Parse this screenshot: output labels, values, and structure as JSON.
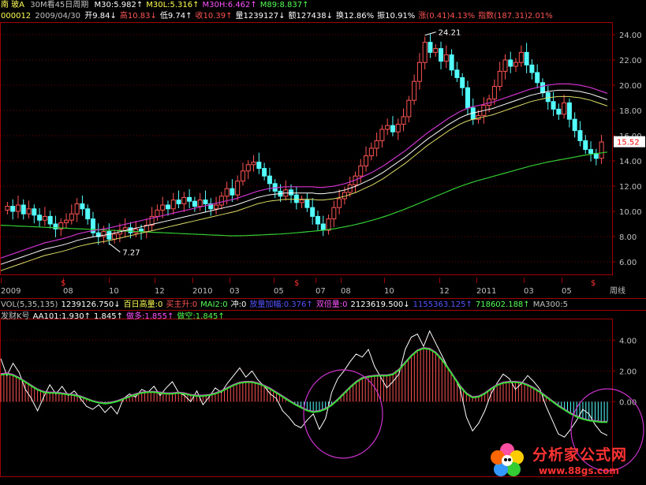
{
  "header": {
    "name": "南  玻A",
    "period": "30M看45日周期",
    "ma": [
      {
        "label": "M30:5.982↑",
        "color": "#ffffff"
      },
      {
        "label": "M30L:5.316↑",
        "color": "#ffff54"
      },
      {
        "label": "M30H:6.462↑",
        "color": "#ff54ff"
      },
      {
        "label": "M89:8.837↑",
        "color": "#54ff54"
      }
    ],
    "code": "000012",
    "date": "2009/04/30",
    "fields": [
      {
        "label": "开9.84↓",
        "color": "#ffffff"
      },
      {
        "label": "高10.83↓",
        "color": "#ff5454"
      },
      {
        "label": "低9.74↑",
        "color": "#ffffff"
      },
      {
        "label": "收10.39↑",
        "color": "#ff5454"
      },
      {
        "label": "量1239127↓",
        "color": "#ffffff"
      },
      {
        "label": "额127438↓",
        "color": "#ffffff"
      },
      {
        "label": "换12.86%",
        "color": "#ffffff"
      },
      {
        "label": "振10.91%",
        "color": "#ffffff"
      },
      {
        "label": "涨(0.41)4.13%",
        "color": "#ff5454"
      },
      {
        "label": "指数(187.31)2.01%",
        "color": "#ff5454"
      }
    ]
  },
  "vol_bar": {
    "items": [
      {
        "label": "VOL(5,35,135)",
        "color": "#c0c0c0"
      },
      {
        "label": "1239126.750↓",
        "color": "#ffffff"
      },
      {
        "label": "百日高量:0",
        "color": "#ffff54"
      },
      {
        "label": "买主升:0",
        "color": "#ff5454"
      },
      {
        "label": "MAI2:0",
        "color": "#54ff54"
      },
      {
        "label": "冲:0",
        "color": "#ffffff"
      },
      {
        "label": "放量加幅:0.376↑",
        "color": "#5454ff"
      },
      {
        "label": "双倍量:0",
        "color": "#ff54ff"
      },
      {
        "label": "2123619.500↓",
        "color": "#ffffff"
      },
      {
        "label": "1155363.125↑",
        "color": "#5454ff"
      },
      {
        "label": "718602.188↑",
        "color": "#54ff54"
      },
      {
        "label": "MA300:5",
        "color": "#c0c0c0"
      }
    ]
  },
  "ind_bar": {
    "items": [
      {
        "label": "发财K号",
        "color": "#c0c0c0"
      },
      {
        "label": "AA101:1.930↑",
        "color": "#ffffff"
      },
      {
        "label": "1.845↑",
        "color": "#ffffff"
      },
      {
        "label": "做多:1.855↑",
        "color": "#ff54ff"
      },
      {
        "label": "做空:1.845↑",
        "color": "#54ff54"
      }
    ]
  },
  "chart_data": [
    {
      "type": "line",
      "subtype": "candlestick",
      "y_ticks": [
        6.0,
        8.0,
        10.0,
        12.0,
        14.0,
        16.0,
        18.0,
        20.0,
        22.0,
        24.0
      ],
      "ylim": [
        5.0,
        25.0
      ],
      "x_ticks": [
        "2009",
        "08",
        "10",
        "12",
        "2010",
        "03",
        "05",
        "07",
        "08",
        "10",
        "12",
        "2011",
        "03",
        "05",
        "周线"
      ],
      "grid": true,
      "annotations": [
        {
          "label": "24.21",
          "value": 24.21
        },
        {
          "label": "7.27",
          "value": 7.27
        },
        {
          "label": "15.52",
          "value": 15.52
        }
      ],
      "dollar_marks": [
        "$",
        "$",
        "$"
      ],
      "closes": [
        10.4,
        10.0,
        10.5,
        9.8,
        10.2,
        9.7,
        9.3,
        9.6,
        9.0,
        8.6,
        9.1,
        9.3,
        9.8,
        10.6,
        10.2,
        9.4,
        8.3,
        8.0,
        8.4,
        7.8,
        8.2,
        8.5,
        8.7,
        8.3,
        8.6,
        8.4,
        8.9,
        9.6,
        10.1,
        10.5,
        10.2,
        10.9,
        10.6,
        11.1,
        10.8,
        10.4,
        10.9,
        10.6,
        10.2,
        10.5,
        11.2,
        11.8,
        11.3,
        12.4,
        13.2,
        13.7,
        13.9,
        13.4,
        12.8,
        12.2,
        11.6,
        11.2,
        11.7,
        11.3,
        10.7,
        10.9,
        10.3,
        9.6,
        9.0,
        8.5,
        9.4,
        10.3,
        11.0,
        11.5,
        12.1,
        12.8,
        13.6,
        14.4,
        15.0,
        15.6,
        16.5,
        16.8,
        16.3,
        16.9,
        17.5,
        18.8,
        20.3,
        21.8,
        23.4,
        22.6,
        22.9,
        21.9,
        22.4,
        21.2,
        20.6,
        19.8,
        18.2,
        17.3,
        17.6,
        18.4,
        18.9,
        19.9,
        21.1,
        22.0,
        21.5,
        21.8,
        22.6,
        21.6,
        21.0,
        20.2,
        19.4,
        18.7,
        18.1,
        17.7,
        18.6,
        17.3,
        16.4,
        15.6,
        14.9,
        14.6,
        14.2,
        15.5
      ],
      "ma_white": [
        5.8,
        5.95,
        6.1,
        6.25,
        6.4,
        6.55,
        6.7,
        6.85,
        7.0,
        7.1,
        7.2,
        7.3,
        7.42,
        7.55,
        7.7,
        7.8,
        7.9,
        7.98,
        8.05,
        8.12,
        8.2,
        8.3,
        8.4,
        8.5,
        8.6,
        8.7,
        8.8,
        8.9,
        9.0,
        9.1,
        9.2,
        9.3,
        9.4,
        9.5,
        9.6,
        9.7,
        9.8,
        9.9,
        10.0,
        10.1,
        10.2,
        10.3,
        10.4,
        10.5,
        10.65,
        10.8,
        10.95,
        11.1,
        11.2,
        11.3,
        11.35,
        11.4,
        11.45,
        11.45,
        11.45,
        11.45,
        11.45,
        11.45,
        11.4,
        11.4,
        11.45,
        11.5,
        11.6,
        11.7,
        11.85,
        12.0,
        12.2,
        12.4,
        12.6,
        12.85,
        13.1,
        13.4,
        13.7,
        14.0,
        14.3,
        14.65,
        15.0,
        15.35,
        15.7,
        16.0,
        16.3,
        16.6,
        16.9,
        17.15,
        17.4,
        17.6,
        17.75,
        17.85,
        17.95,
        18.05,
        18.15,
        18.3,
        18.45,
        18.6,
        18.75,
        18.9,
        19.05,
        19.2,
        19.3,
        19.4,
        19.5,
        19.55,
        19.6,
        19.6,
        19.6,
        19.55,
        19.5,
        19.4,
        19.3,
        19.15,
        19.0,
        18.85
      ],
      "ma_yellow": [
        5.3,
        5.45,
        5.6,
        5.75,
        5.9,
        6.05,
        6.2,
        6.35,
        6.5,
        6.6,
        6.7,
        6.8,
        6.92,
        7.05,
        7.2,
        7.3,
        7.4,
        7.48,
        7.55,
        7.62,
        7.7,
        7.8,
        7.9,
        8.0,
        8.1,
        8.2,
        8.3,
        8.4,
        8.5,
        8.6,
        8.7,
        8.8,
        8.9,
        9.0,
        9.1,
        9.2,
        9.3,
        9.4,
        9.5,
        9.6,
        9.7,
        9.8,
        9.9,
        10.0,
        10.15,
        10.3,
        10.45,
        10.6,
        10.7,
        10.8,
        10.85,
        10.9,
        10.95,
        10.95,
        10.95,
        10.95,
        10.95,
        10.95,
        10.9,
        10.9,
        10.95,
        11.0,
        11.1,
        11.2,
        11.35,
        11.5,
        11.7,
        11.9,
        12.1,
        12.35,
        12.6,
        12.9,
        13.2,
        13.5,
        13.8,
        14.15,
        14.5,
        14.85,
        15.2,
        15.5,
        15.8,
        16.1,
        16.4,
        16.65,
        16.9,
        17.1,
        17.25,
        17.35,
        17.45,
        17.55,
        17.65,
        17.8,
        17.95,
        18.1,
        18.25,
        18.4,
        18.55,
        18.7,
        18.8,
        18.9,
        19.0,
        19.05,
        19.1,
        19.1,
        19.1,
        19.05,
        19.0,
        18.9,
        18.8,
        18.65,
        18.5,
        18.35
      ],
      "ma_magenta": [
        6.3,
        6.45,
        6.6,
        6.75,
        6.9,
        7.05,
        7.2,
        7.35,
        7.5,
        7.6,
        7.7,
        7.8,
        7.92,
        8.05,
        8.2,
        8.3,
        8.4,
        8.48,
        8.55,
        8.62,
        8.7,
        8.8,
        8.9,
        9.0,
        9.1,
        9.2,
        9.3,
        9.4,
        9.5,
        9.6,
        9.7,
        9.8,
        9.9,
        10.0,
        10.1,
        10.2,
        10.3,
        10.4,
        10.5,
        10.6,
        10.7,
        10.8,
        10.9,
        11.0,
        11.15,
        11.3,
        11.45,
        11.6,
        11.7,
        11.8,
        11.85,
        11.9,
        11.95,
        11.95,
        11.95,
        11.95,
        11.95,
        11.95,
        11.9,
        11.9,
        11.95,
        12.0,
        12.1,
        12.2,
        12.35,
        12.5,
        12.7,
        12.9,
        13.1,
        13.35,
        13.6,
        13.9,
        14.2,
        14.5,
        14.8,
        15.15,
        15.5,
        15.85,
        16.2,
        16.5,
        16.8,
        17.1,
        17.4,
        17.65,
        17.9,
        18.1,
        18.25,
        18.35,
        18.45,
        18.55,
        18.65,
        18.8,
        18.95,
        19.1,
        19.25,
        19.4,
        19.55,
        19.7,
        19.8,
        19.9,
        20.0,
        20.05,
        20.1,
        20.1,
        20.1,
        20.05,
        20.0,
        19.9,
        19.8,
        19.65,
        19.5,
        19.35
      ],
      "ma_green": [
        8.9,
        8.88,
        8.86,
        8.84,
        8.82,
        8.8,
        8.78,
        8.76,
        8.74,
        8.72,
        8.7,
        8.68,
        8.66,
        8.64,
        8.62,
        8.6,
        8.58,
        8.56,
        8.54,
        8.52,
        8.5,
        8.48,
        8.46,
        8.44,
        8.42,
        8.4,
        8.38,
        8.36,
        8.34,
        8.32,
        8.3,
        8.28,
        8.26,
        8.24,
        8.22,
        8.2,
        8.18,
        8.16,
        8.14,
        8.12,
        8.1,
        8.08,
        8.06,
        8.06,
        8.07,
        8.08,
        8.1,
        8.12,
        8.14,
        8.16,
        8.18,
        8.2,
        8.23,
        8.26,
        8.3,
        8.34,
        8.38,
        8.42,
        8.46,
        8.5,
        8.56,
        8.62,
        8.7,
        8.78,
        8.86,
        8.96,
        9.06,
        9.18,
        9.3,
        9.42,
        9.56,
        9.7,
        9.86,
        10.02,
        10.18,
        10.36,
        10.54,
        10.72,
        10.9,
        11.08,
        11.26,
        11.44,
        11.62,
        11.8,
        11.96,
        12.12,
        12.26,
        12.4,
        12.52,
        12.64,
        12.76,
        12.88,
        13.0,
        13.12,
        13.24,
        13.36,
        13.48,
        13.6,
        13.7,
        13.8,
        13.9,
        13.98,
        14.06,
        14.14,
        14.22,
        14.3,
        14.38,
        14.46,
        14.52,
        14.58,
        14.64,
        14.7
      ]
    },
    {
      "type": "line",
      "name": "发财K号",
      "y_ticks": [
        0.0,
        2.0,
        4.0
      ],
      "ylim": [
        -2.6,
        5.2
      ],
      "series": [
        {
          "name": "AA101",
          "values": [
            2.8,
            1.7,
            2.5,
            1.9,
            0.8,
            0.2,
            -0.6,
            0.3,
            1.1,
            0.5,
            1.0,
            0.4,
            0.7,
            0.2,
            -0.3,
            -0.5,
            -0.2,
            -0.7,
            -0.3,
            -0.8,
            0.2,
            0.5,
            0.3,
            0.8,
            0.6,
            1.0,
            0.4,
            0.9,
            1.3,
            0.6,
            0.4,
            0.0,
            0.7,
            -0.2,
            0.3,
            0.9,
            0.6,
            1.2,
            1.7,
            2.2,
            1.6,
            2.0,
            1.4,
            1.0,
            0.5,
            0.2,
            -0.6,
            -1.0,
            -1.5,
            -1.7,
            -1.2,
            -0.8,
            -1.8,
            -1.1,
            0.6,
            1.5,
            2.0,
            2.6,
            3.1,
            2.9,
            3.4,
            2.3,
            1.6,
            0.9,
            1.3,
            1.8,
            3.4,
            4.2,
            4.4,
            3.6,
            4.6,
            3.8,
            3.0,
            2.2,
            1.6,
            0.8,
            -1.0,
            -1.9,
            -1.4,
            -0.6,
            0.5,
            1.2,
            1.8,
            1.5,
            0.8,
            1.2,
            1.7,
            1.3,
            0.8,
            -0.3,
            -1.2,
            -2.1,
            -2.3,
            -1.8,
            -1.2,
            -0.5,
            -0.8,
            -1.5,
            -2.0,
            -2.2
          ]
        },
        {
          "name": "做多",
          "values": [
            1.8,
            1.85,
            1.75,
            1.55,
            1.3,
            1.05,
            0.8,
            0.65,
            0.6,
            0.6,
            0.55,
            0.5,
            0.45,
            0.35,
            0.2,
            0.05,
            -0.05,
            -0.1,
            -0.05,
            0.05,
            0.2,
            0.35,
            0.5,
            0.6,
            0.65,
            0.65,
            0.6,
            0.55,
            0.55,
            0.6,
            0.55,
            0.45,
            0.4,
            0.4,
            0.45,
            0.55,
            0.7,
            0.9,
            1.1,
            1.25,
            1.3,
            1.3,
            1.2,
            1.05,
            0.85,
            0.6,
            0.35,
            0.1,
            -0.15,
            -0.35,
            -0.55,
            -0.65,
            -0.6,
            -0.45,
            -0.2,
            0.15,
            0.55,
            0.95,
            1.3,
            1.55,
            1.65,
            1.7,
            1.72,
            1.72,
            1.8,
            2.1,
            2.55,
            3.0,
            3.35,
            3.5,
            3.45,
            3.2,
            2.75,
            2.2,
            1.6,
            1.0,
            0.55,
            0.3,
            0.35,
            0.55,
            0.85,
            1.1,
            1.25,
            1.3,
            1.3,
            1.25,
            1.1,
            0.9,
            0.65,
            0.35,
            0.05,
            -0.25,
            -0.5,
            -0.75,
            -0.95,
            -1.1,
            -1.2,
            -1.25,
            -1.3,
            -1.3
          ]
        },
        {
          "name": "做空",
          "values": [
            1.75,
            1.8,
            1.72,
            1.52,
            1.28,
            1.02,
            0.78,
            0.62,
            0.57,
            0.57,
            0.52,
            0.47,
            0.42,
            0.32,
            0.18,
            0.03,
            -0.07,
            -0.12,
            -0.08,
            0.02,
            0.17,
            0.32,
            0.47,
            0.57,
            0.62,
            0.62,
            0.57,
            0.52,
            0.52,
            0.57,
            0.52,
            0.42,
            0.37,
            0.37,
            0.42,
            0.52,
            0.67,
            0.87,
            1.07,
            1.22,
            1.27,
            1.27,
            1.17,
            1.02,
            0.82,
            0.57,
            0.32,
            0.07,
            -0.18,
            -0.38,
            -0.58,
            -0.68,
            -0.63,
            -0.48,
            -0.23,
            0.12,
            0.52,
            0.92,
            1.27,
            1.52,
            1.62,
            1.67,
            1.69,
            1.69,
            1.77,
            2.07,
            2.52,
            2.97,
            3.32,
            3.47,
            3.42,
            3.17,
            2.72,
            2.17,
            1.57,
            0.97,
            0.52,
            0.27,
            0.32,
            0.52,
            0.82,
            1.07,
            1.22,
            1.27,
            1.27,
            1.22,
            1.07,
            0.87,
            0.62,
            0.32,
            0.02,
            -0.28,
            -0.53,
            -0.78,
            -0.98,
            -1.13,
            -1.23,
            -1.28,
            -1.33,
            -1.33
          ]
        }
      ]
    }
  ],
  "logo": {
    "text": "分析家公式网",
    "url_text": "www.88gs.com",
    "icon": "flower-logo-icon"
  }
}
